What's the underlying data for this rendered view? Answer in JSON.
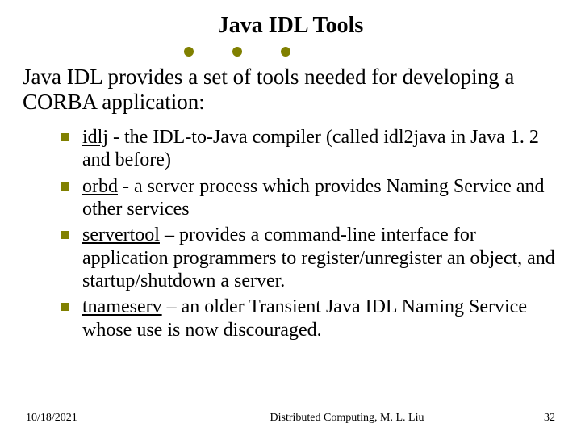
{
  "title": "Java IDL Tools",
  "intro": "Java IDL provides a set of tools needed for developing a CORBA application:",
  "items": [
    {
      "tool": "idlj",
      "desc": " - the IDL-to-Java compiler (called idl2java in Java 1. 2 and before)"
    },
    {
      "tool": "orbd",
      "lead": " ",
      "desc": " - a server process which provides Naming Service and other services"
    },
    {
      "tool": "servertool",
      "desc": " – provides a command-line interface for application programmers to register/unregister an object,  and startup/shutdown a server."
    },
    {
      "tool": "tnameserv",
      "desc": " – an older Transient Java IDL Naming Service whose use is now discouraged."
    }
  ],
  "footer": {
    "date": "10/18/2021",
    "center": "Distributed Computing, M. L. Liu",
    "page": "32"
  }
}
